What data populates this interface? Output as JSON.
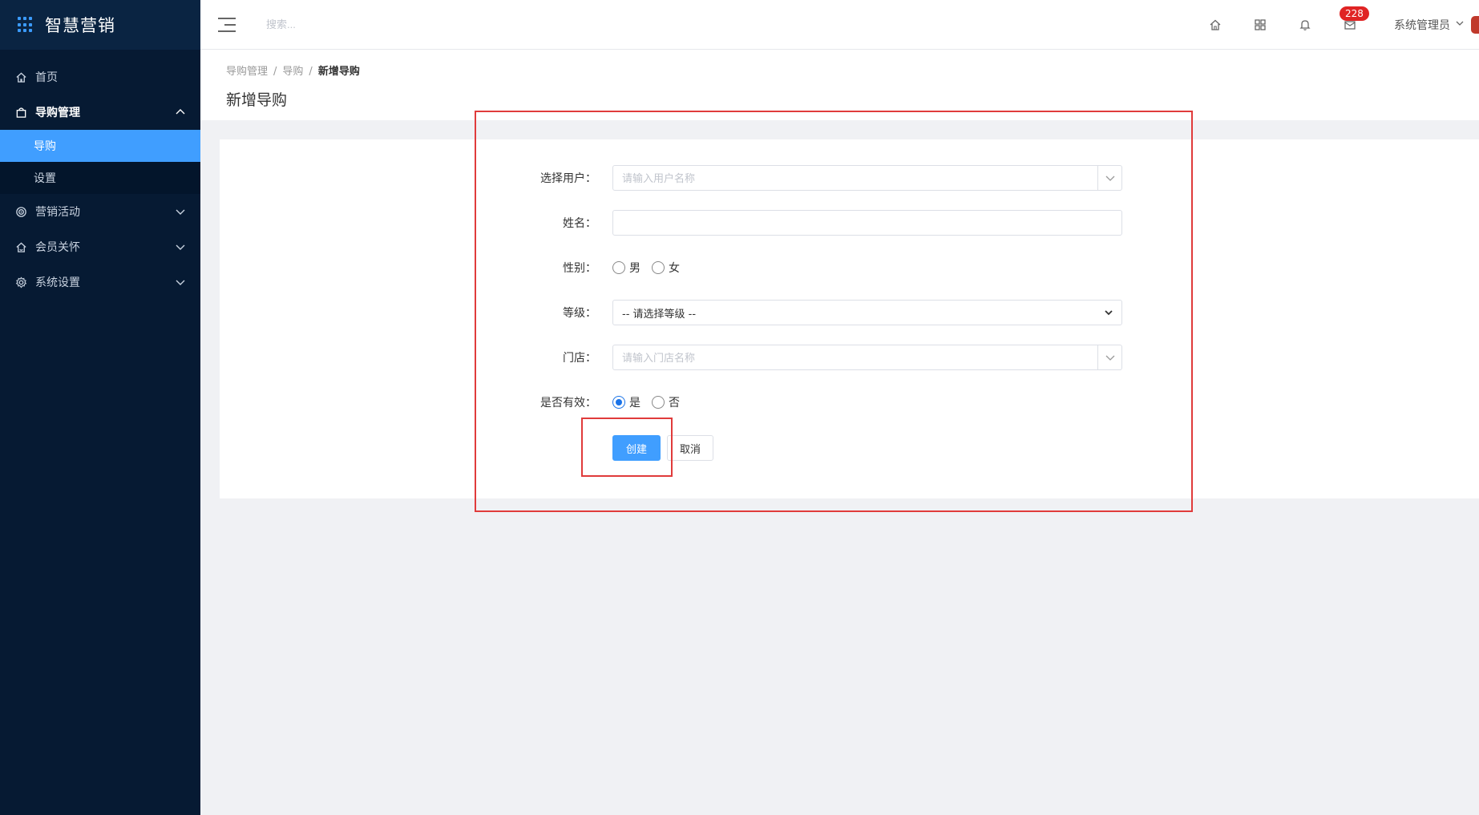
{
  "app": {
    "title": "智慧营销"
  },
  "sidebar": {
    "items": [
      {
        "label": "首页",
        "icon": "home-icon"
      },
      {
        "label": "导购管理",
        "icon": "bag-icon",
        "open": true,
        "children": [
          {
            "label": "导购",
            "active": true
          },
          {
            "label": "设置"
          }
        ]
      },
      {
        "label": "营销活动",
        "icon": "target-icon"
      },
      {
        "label": "会员关怀",
        "icon": "member-home-icon"
      },
      {
        "label": "系统设置",
        "icon": "gear-icon"
      }
    ]
  },
  "header": {
    "search_placeholder": "搜索...",
    "notification_count": "228",
    "user_name": "系统管理员"
  },
  "breadcrumb": {
    "items": [
      "导购管理",
      "导购"
    ],
    "current": "新增导购",
    "separator": "/"
  },
  "page": {
    "title": "新增导购"
  },
  "form": {
    "user": {
      "label": "选择用户：",
      "placeholder": "请输入用户名称"
    },
    "name": {
      "label": "姓名：",
      "value": ""
    },
    "gender": {
      "label": "性别：",
      "options": [
        "男",
        "女"
      ],
      "selected": null
    },
    "level": {
      "label": "等级：",
      "selected": "-- 请选择等级 --"
    },
    "store": {
      "label": "门店：",
      "placeholder": "请输入门店名称"
    },
    "valid": {
      "label": "是否有效：",
      "options": [
        "是",
        "否"
      ],
      "selected": "是"
    },
    "submit_label": "创建",
    "cancel_label": "取消"
  },
  "colors": {
    "sidebar_bg": "#061a33",
    "accent": "#409eff",
    "badge": "#e02424",
    "annotation": "#e03b3b"
  }
}
